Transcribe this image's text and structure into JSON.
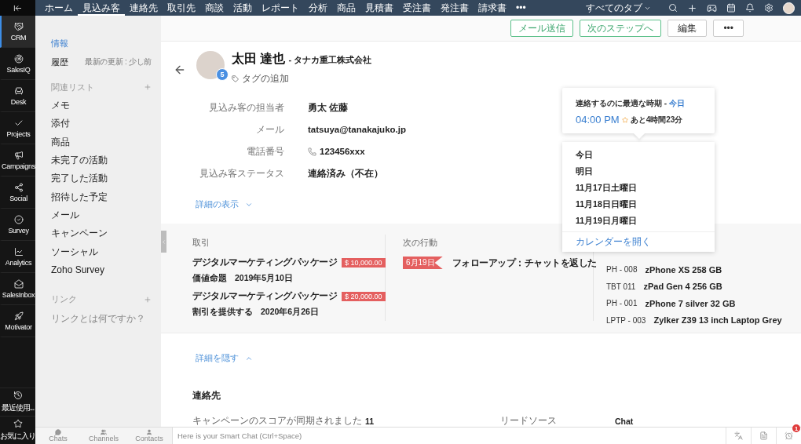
{
  "rail": {
    "items": [
      {
        "label": "CRM",
        "kind": "handshake",
        "selected": true
      },
      {
        "label": "SalesIQ",
        "kind": "radar",
        "selected": false
      },
      {
        "label": "Desk",
        "kind": "chair",
        "selected": false
      },
      {
        "label": "Projects",
        "kind": "check",
        "selected": false
      },
      {
        "label": "Campaigns",
        "kind": "megaphone",
        "selected": false
      },
      {
        "label": "Social",
        "kind": "share",
        "selected": false
      },
      {
        "label": "Survey",
        "kind": "circle-check",
        "selected": false
      },
      {
        "label": "Analytics",
        "kind": "chart",
        "selected": false
      },
      {
        "label": "SalesInbox",
        "kind": "inbox",
        "selected": false
      },
      {
        "label": "Motivator",
        "kind": "rocket",
        "selected": false
      }
    ],
    "bottom": [
      {
        "label": "最近使用...",
        "kind": "history"
      },
      {
        "label": "お気に入り",
        "kind": "star"
      }
    ]
  },
  "topnav": {
    "tabs": [
      {
        "label": "ホーム",
        "selected": false
      },
      {
        "label": "見込み客",
        "selected": true
      },
      {
        "label": "連絡先",
        "selected": false
      },
      {
        "label": "取引先",
        "selected": false
      },
      {
        "label": "商談",
        "selected": false
      },
      {
        "label": "活動",
        "selected": false
      },
      {
        "label": "レポート",
        "selected": false
      },
      {
        "label": "分析",
        "selected": false
      },
      {
        "label": "商品",
        "selected": false
      },
      {
        "label": "見積書",
        "selected": false
      },
      {
        "label": "受注書",
        "selected": false
      },
      {
        "label": "発注書",
        "selected": false
      },
      {
        "label": "請求書",
        "selected": false
      },
      {
        "label": "•••",
        "selected": false
      }
    ],
    "all_tabs": "すべてのタブ"
  },
  "sidebar": {
    "items": [
      {
        "label": "情報",
        "selected": true
      },
      {
        "label": "履歴",
        "selected": false,
        "note": "最新の更新 : 少し前"
      }
    ],
    "related": {
      "title": "関連リスト",
      "items": [
        "メモ",
        "添付",
        "商品",
        "未完了の活動",
        "完了した活動",
        "招待した予定",
        "メール",
        "キャンペーン",
        "ソーシャル",
        "Zoho Survey"
      ]
    },
    "links": {
      "title": "リンク",
      "help": "リンクとは何ですか？"
    }
  },
  "toolbar": {
    "buttons": [
      {
        "label": "メール送信",
        "kind": "primary"
      },
      {
        "label": "次のステップへ",
        "kind": "primary"
      },
      {
        "label": "編集",
        "kind": "default"
      },
      {
        "label": "•••",
        "kind": "default"
      }
    ]
  },
  "record": {
    "name": "太田 達也",
    "company": "- タナカ重工株式会社",
    "badge": "5",
    "tag_add": "タグの追加",
    "fields": [
      {
        "label": "見込み客の担当者",
        "value": "勇太 佐藤"
      },
      {
        "label": "メール",
        "value": "tatsuya@tanakajuko.jp"
      },
      {
        "label": "電話番号",
        "value": "123456xxx",
        "kind": "phone"
      },
      {
        "label": "見込み客ステータス",
        "value": "連絡済み（不在）"
      }
    ],
    "show_details": "詳細の表示",
    "hide_details": "詳細を隠す"
  },
  "summary": {
    "deals": {
      "title": "取引",
      "items": [
        {
          "name": "デジタルマーケティングパッケージ",
          "amount": "$ 10,000.00",
          "stage": "価値命題",
          "date": "2019年5月10日"
        },
        {
          "name": "デジタルマーケティングパッケージ",
          "amount": "$ 20,000.00",
          "stage": "割引を提供する",
          "date": "2020年6月26日"
        }
      ]
    },
    "next_action": {
      "title": "次の行動",
      "date": "6月19日",
      "text": "フォローアップ：チャットを返した"
    },
    "products": [
      {
        "code": "PH - 008",
        "name": "zPhone XS 258 GB"
      },
      {
        "code": "TBT 011",
        "name": "zPad Gen 4 256 GB"
      },
      {
        "code": "PH - 001",
        "name": "zPhone 7 silver 32 GB"
      },
      {
        "code": "LPTP - 003",
        "name": "Zylker Z39 13 inch Laptop Grey"
      }
    ]
  },
  "contact": {
    "title": "連絡先",
    "fields": [
      {
        "label": "キャンペーンのスコアが同期されました",
        "value": "11"
      },
      {
        "label": "リードソース",
        "value": "Chat"
      }
    ]
  },
  "best_time": {
    "title": "連絡するのに最適な時期 - ",
    "day": "今日",
    "time": "04:00 PM",
    "remaining": "あと4時間23分",
    "options": [
      "今日",
      "明日",
      "11月17日土曜日",
      "11月18日日曜日",
      "11月19日月曜日"
    ],
    "calendar_link": "カレンダーを開く"
  },
  "bottom_bar": {
    "tabs": [
      {
        "label": "Chats",
        "kind": "chat"
      },
      {
        "label": "Channels",
        "kind": "users"
      },
      {
        "label": "Contacts",
        "kind": "user"
      }
    ],
    "placeholder": "Here is your Smart Chat (Ctrl+Space)",
    "alert_badge": "1"
  }
}
